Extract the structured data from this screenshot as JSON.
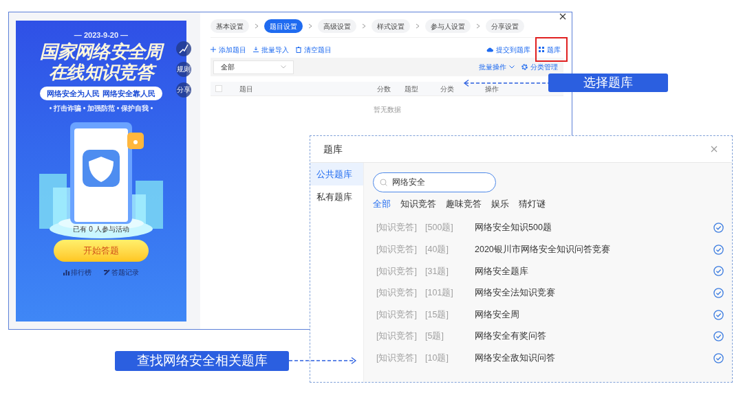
{
  "poster": {
    "date": "— 2023-9-20 —",
    "title_lines": [
      "国家网络安全周",
      "在线知识竞答"
    ],
    "slogan": "网络安全为人民 网络安全靠人民",
    "tagline": "• 打击诈骗 • 加强防范 • 保护自我 •",
    "side_buttons": [
      {
        "kind": "icon"
      },
      {
        "kind": "text",
        "label": "规则"
      },
      {
        "kind": "text",
        "label": "分享"
      }
    ],
    "participants": "已有 0 人参与活动",
    "start_button": "开始答题",
    "links": [
      {
        "kind": "ranking",
        "label": "排行榜"
      },
      {
        "kind": "records",
        "label": "答题记录"
      }
    ]
  },
  "steps": [
    {
      "label": "基本设置",
      "selected": false
    },
    {
      "label": "题目设置",
      "selected": true
    },
    {
      "label": "高级设置",
      "selected": false
    },
    {
      "label": "样式设置",
      "selected": false
    },
    {
      "label": "参与人设置",
      "selected": false
    },
    {
      "label": "分享设置",
      "selected": false
    }
  ],
  "toolbar": {
    "left": [
      {
        "kind": "add",
        "label": "添加题目"
      },
      {
        "kind": "import",
        "label": "批量导入"
      },
      {
        "kind": "clear",
        "label": "清空题目"
      }
    ],
    "right": [
      {
        "kind": "submit",
        "label": "提交到题库"
      },
      {
        "kind": "library",
        "label": "题库"
      }
    ]
  },
  "filter": {
    "value": "全部",
    "batch": "批量操作",
    "category_manage": "分类管理"
  },
  "table": {
    "select_all": {
      "checked": false
    },
    "columns": [
      "题目",
      "分数",
      "题型",
      "分类",
      "操作"
    ],
    "empty_text": "暂无数据"
  },
  "dialog": {
    "title": "题库",
    "nav": [
      {
        "label": "公共题库",
        "selected": true
      },
      {
        "label": "私有题库",
        "selected": false
      }
    ],
    "search": {
      "value": "网络安全"
    },
    "tabs": [
      {
        "label": "全部",
        "selected": true
      },
      {
        "label": "知识竞答",
        "selected": false
      },
      {
        "label": "趣味竞答",
        "selected": false
      },
      {
        "label": "娱乐",
        "selected": false
      },
      {
        "label": "猜灯谜",
        "selected": false
      }
    ],
    "rows": [
      {
        "category": "[知识竞答]",
        "count": "[500题]",
        "title": "网络安全知识500题"
      },
      {
        "category": "[知识竞答]",
        "count": "[40题]",
        "title": "2020银川市网络安全知识问答竞赛"
      },
      {
        "category": "[知识竞答]",
        "count": "[31题]",
        "title": "网络安全题库"
      },
      {
        "category": "[知识竞答]",
        "count": "[101题]",
        "title": "网络安全法知识竞赛"
      },
      {
        "category": "[知识竞答]",
        "count": "[15题]",
        "title": "网络安全周"
      },
      {
        "category": "[知识竞答]",
        "count": "[5题]",
        "title": "网络安全有奖问答"
      },
      {
        "category": "[知识竞答]",
        "count": "[10题]",
        "title": "网络安全敌知识问答"
      }
    ]
  },
  "callouts": [
    {
      "text": "选择题库"
    },
    {
      "text": "查找网络安全相关题库"
    }
  ]
}
